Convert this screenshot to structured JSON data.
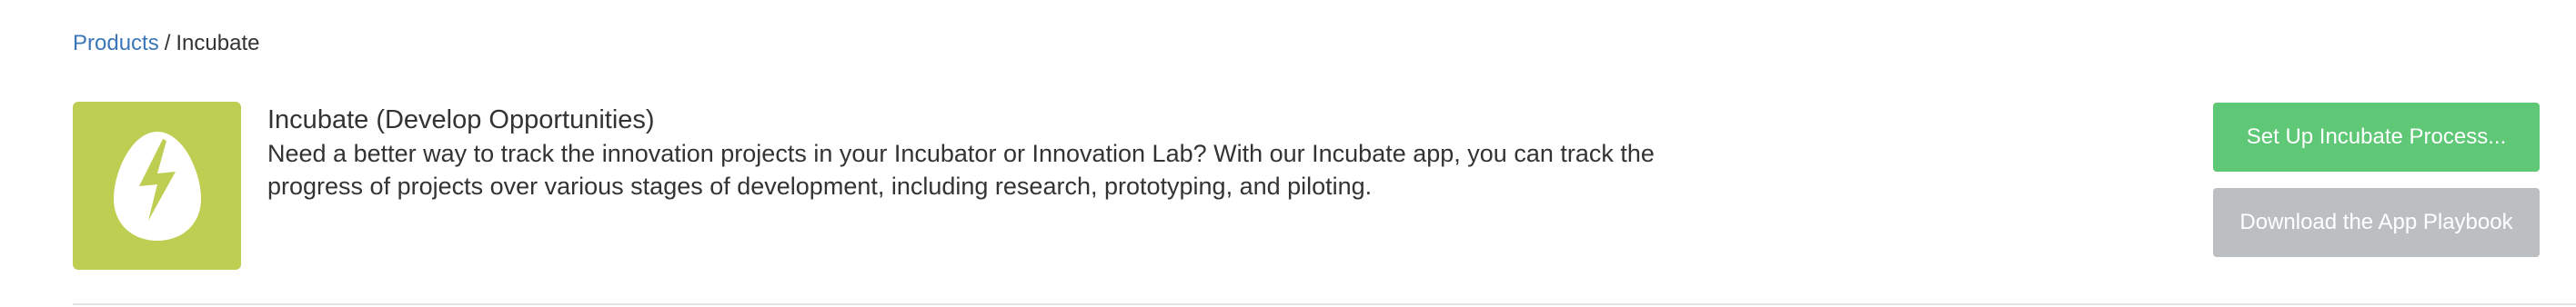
{
  "breadcrumb": {
    "parent_label": "Products",
    "separator": "/",
    "current_label": "Incubate"
  },
  "product": {
    "icon": "lightning-egg-icon",
    "tile_color": "#bece53",
    "title": "Incubate (Develop Opportunities)",
    "description": "Need a better way to track the innovation projects in your Incubator or Innovation Lab? With our Incubate app, you can track the progress of projects over various stages of development, including research, prototyping, and piloting."
  },
  "actions": {
    "setup_label": "Set Up Incubate Process...",
    "setup_color": "#5fc877",
    "download_label": "Download the App Playbook",
    "download_color": "#bcbfc2"
  }
}
